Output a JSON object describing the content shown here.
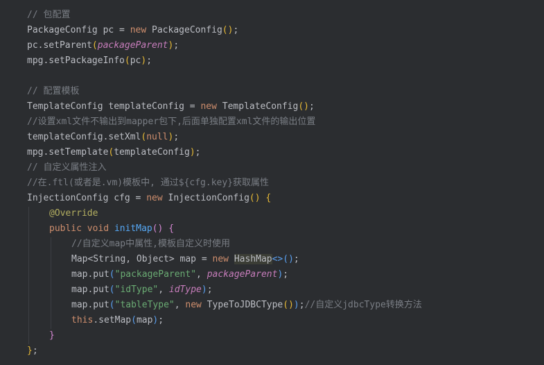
{
  "editor": {
    "code_lines": [
      {
        "indent": 0,
        "tokens": [
          {
            "t": "// 包配置",
            "c": "cm"
          }
        ]
      },
      {
        "indent": 0,
        "tokens": [
          {
            "t": "PackageConfig pc = ",
            "c": ""
          },
          {
            "t": "new",
            "c": "kw"
          },
          {
            "t": " PackageConfig",
            "c": ""
          },
          {
            "t": "()",
            "c": "br1"
          },
          {
            "t": ";",
            "c": ""
          }
        ]
      },
      {
        "indent": 0,
        "tokens": [
          {
            "t": "pc.setParent",
            "c": ""
          },
          {
            "t": "(",
            "c": "br1"
          },
          {
            "t": "packageParent",
            "c": "fld"
          },
          {
            "t": ")",
            "c": "br1"
          },
          {
            "t": ";",
            "c": ""
          }
        ]
      },
      {
        "indent": 0,
        "tokens": [
          {
            "t": "mpg.setPackageInfo",
            "c": ""
          },
          {
            "t": "(",
            "c": "br1"
          },
          {
            "t": "pc",
            "c": ""
          },
          {
            "t": ")",
            "c": "br1"
          },
          {
            "t": ";",
            "c": ""
          }
        ]
      },
      {
        "indent": 0,
        "tokens": []
      },
      {
        "indent": 0,
        "tokens": [
          {
            "t": "// 配置模板",
            "c": "cm"
          }
        ]
      },
      {
        "indent": 0,
        "tokens": [
          {
            "t": "TemplateConfig templateConfig = ",
            "c": ""
          },
          {
            "t": "new",
            "c": "kw"
          },
          {
            "t": " TemplateConfig",
            "c": ""
          },
          {
            "t": "()",
            "c": "br1"
          },
          {
            "t": ";",
            "c": ""
          }
        ]
      },
      {
        "indent": 0,
        "tokens": [
          {
            "t": "//设置xml文件不输出到mapper包下,后面单独配置xml文件的输出位置",
            "c": "cm"
          }
        ]
      },
      {
        "indent": 0,
        "tokens": [
          {
            "t": "templateConfig.setXml",
            "c": ""
          },
          {
            "t": "(",
            "c": "br1"
          },
          {
            "t": "null",
            "c": "kw"
          },
          {
            "t": ")",
            "c": "br1"
          },
          {
            "t": ";",
            "c": ""
          }
        ]
      },
      {
        "indent": 0,
        "tokens": [
          {
            "t": "mpg.setTemplate",
            "c": ""
          },
          {
            "t": "(",
            "c": "br1"
          },
          {
            "t": "templateConfig",
            "c": ""
          },
          {
            "t": ")",
            "c": "br1"
          },
          {
            "t": ";",
            "c": ""
          }
        ]
      },
      {
        "indent": 0,
        "tokens": [
          {
            "t": "// 自定义属性注入",
            "c": "cm"
          }
        ]
      },
      {
        "indent": 0,
        "tokens": [
          {
            "t": "//在.ftl(或者是.vm)模板中, 通过${cfg.key}获取属性",
            "c": "cm"
          }
        ]
      },
      {
        "indent": 0,
        "tokens": [
          {
            "t": "InjectionConfig cfg = ",
            "c": ""
          },
          {
            "t": "new",
            "c": "kw"
          },
          {
            "t": " InjectionConfig",
            "c": ""
          },
          {
            "t": "()",
            "c": "br1"
          },
          {
            "t": " ",
            "c": ""
          },
          {
            "t": "{",
            "c": "br1"
          }
        ]
      },
      {
        "indent": 1,
        "tokens": [
          {
            "t": "@Override",
            "c": "ann"
          }
        ]
      },
      {
        "indent": 1,
        "tokens": [
          {
            "t": "public",
            "c": "kw"
          },
          {
            "t": " ",
            "c": ""
          },
          {
            "t": "void",
            "c": "kw"
          },
          {
            "t": " ",
            "c": ""
          },
          {
            "t": "initMap",
            "c": "fn"
          },
          {
            "t": "()",
            "c": "br2"
          },
          {
            "t": " ",
            "c": ""
          },
          {
            "t": "{",
            "c": "br2"
          }
        ]
      },
      {
        "indent": 2,
        "tokens": [
          {
            "t": "//自定义map中属性,模板自定义时使用",
            "c": "cm"
          }
        ]
      },
      {
        "indent": 2,
        "tokens": [
          {
            "t": "Map<String, Object> map = ",
            "c": ""
          },
          {
            "t": "new",
            "c": "kw"
          },
          {
            "t": " ",
            "c": ""
          },
          {
            "t": "HashMap",
            "c": "hl"
          },
          {
            "t": "<>()",
            "c": "br3"
          },
          {
            "t": ";",
            "c": ""
          }
        ]
      },
      {
        "indent": 2,
        "tokens": [
          {
            "t": "map.put",
            "c": ""
          },
          {
            "t": "(",
            "c": "br3"
          },
          {
            "t": "\"packageParent\"",
            "c": "str"
          },
          {
            "t": ", ",
            "c": ""
          },
          {
            "t": "packageParent",
            "c": "fld"
          },
          {
            "t": ")",
            "c": "br3"
          },
          {
            "t": ";",
            "c": ""
          }
        ]
      },
      {
        "indent": 2,
        "tokens": [
          {
            "t": "map.put",
            "c": ""
          },
          {
            "t": "(",
            "c": "br3"
          },
          {
            "t": "\"idType\"",
            "c": "str"
          },
          {
            "t": ", ",
            "c": ""
          },
          {
            "t": "idType",
            "c": "fld"
          },
          {
            "t": ")",
            "c": "br3"
          },
          {
            "t": ";",
            "c": ""
          }
        ]
      },
      {
        "indent": 2,
        "tokens": [
          {
            "t": "map.put",
            "c": ""
          },
          {
            "t": "(",
            "c": "br3"
          },
          {
            "t": "\"tableType\"",
            "c": "str"
          },
          {
            "t": ", ",
            "c": ""
          },
          {
            "t": "new",
            "c": "kw"
          },
          {
            "t": " TypeToJDBCType",
            "c": ""
          },
          {
            "t": "()",
            "c": "br1"
          },
          {
            "t": ")",
            "c": "br3"
          },
          {
            "t": ";",
            "c": ""
          },
          {
            "t": "//自定义jdbcType转换方法",
            "c": "cm"
          }
        ]
      },
      {
        "indent": 2,
        "tokens": [
          {
            "t": "this",
            "c": "kw"
          },
          {
            "t": ".setMap",
            "c": ""
          },
          {
            "t": "(",
            "c": "br3"
          },
          {
            "t": "map",
            "c": ""
          },
          {
            "t": ")",
            "c": "br3"
          },
          {
            "t": ";",
            "c": ""
          }
        ]
      },
      {
        "indent": 1,
        "tokens": [
          {
            "t": "}",
            "c": "br2"
          }
        ]
      },
      {
        "indent": 0,
        "tokens": [
          {
            "t": "}",
            "c": "br1"
          },
          {
            "t": ";",
            "c": ""
          }
        ]
      }
    ]
  }
}
